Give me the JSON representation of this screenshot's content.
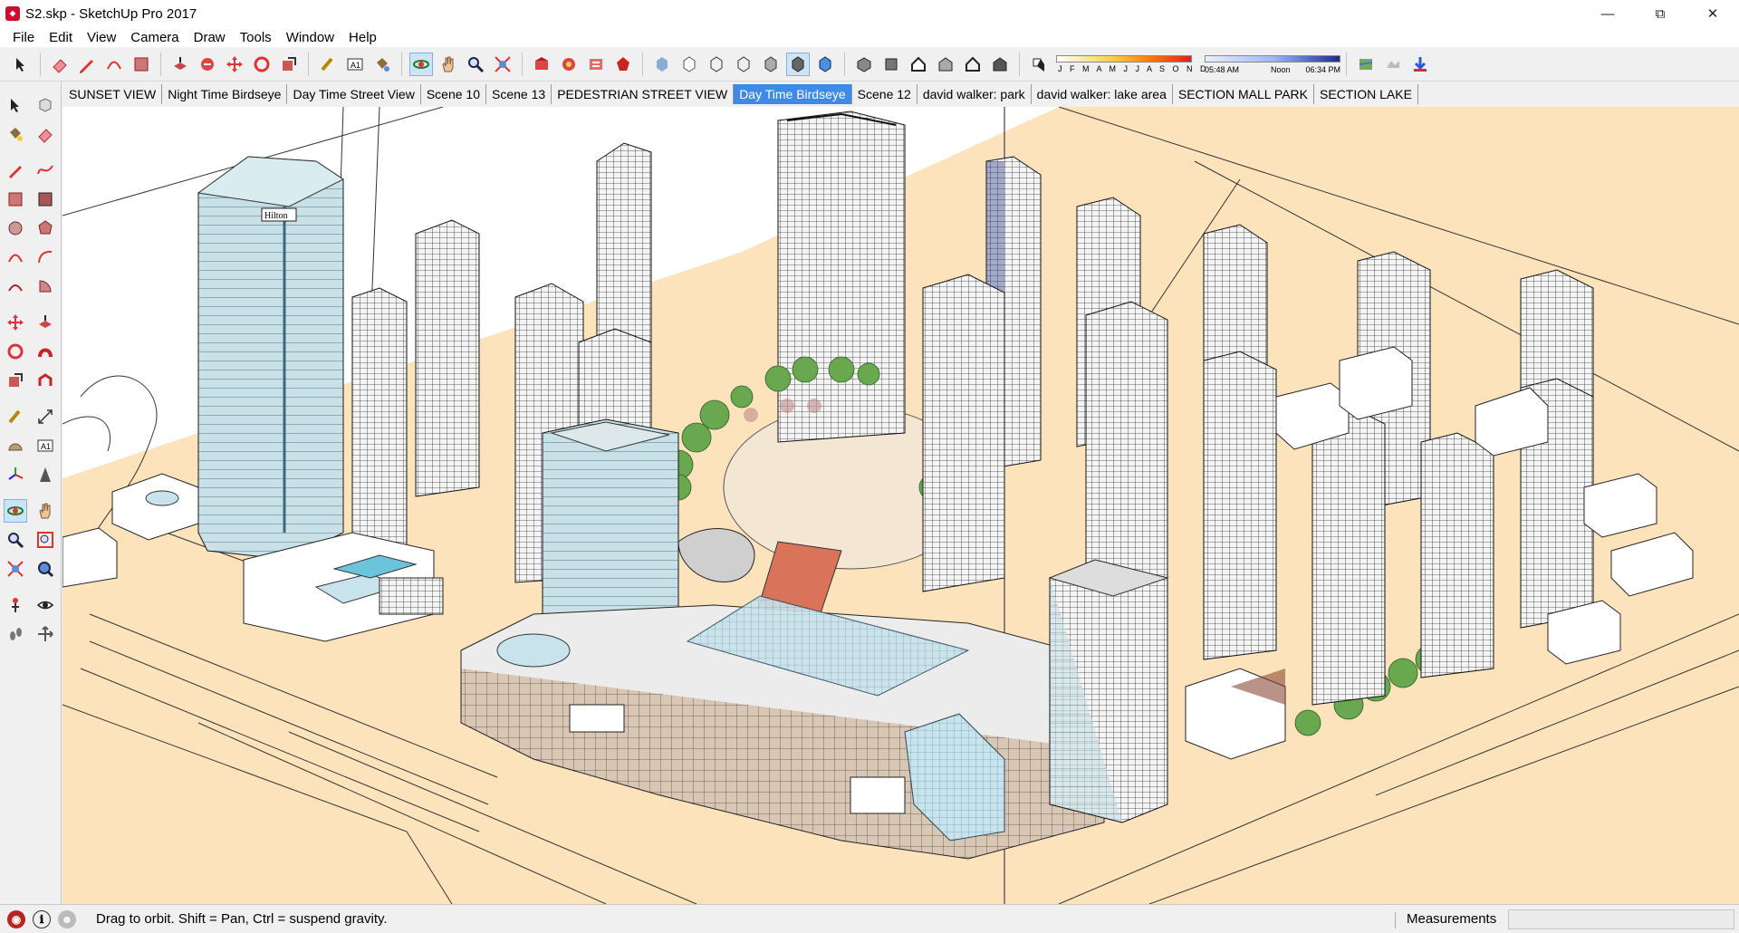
{
  "window": {
    "title": "S2.skp - SketchUp Pro 2017",
    "controls": [
      "minimize",
      "maximize",
      "close"
    ]
  },
  "menu": [
    "File",
    "Edit",
    "View",
    "Camera",
    "Draw",
    "Tools",
    "Window",
    "Help"
  ],
  "toolbar": {
    "shadow_months": "J F M A M J J A S O N D",
    "shadow_time_start": "05:48 AM",
    "shadow_time_mid": "Noon",
    "shadow_time_end": "06:34 PM",
    "accent_color": "#3d8be6"
  },
  "scenes": {
    "tabs": [
      "SUNSET VIEW",
      "Night Time Birdseye",
      "Day Time Street View",
      "Scene 10",
      "Scene 13",
      "PEDESTRIAN STREET VIEW",
      "Day Time Birdseye",
      "Scene 12",
      "david walker: park",
      "david walker: lake area",
      "SECTION MALL PARK",
      "SECTION LAKE"
    ],
    "active_index": 6
  },
  "viewport": {
    "ground_color": "#fde3bb",
    "sign_text": "Hilton"
  },
  "status": {
    "message": "Drag to orbit. Shift = Pan, Ctrl = suspend gravity.",
    "measurements_label": "Measurements",
    "measurements_value": ""
  }
}
